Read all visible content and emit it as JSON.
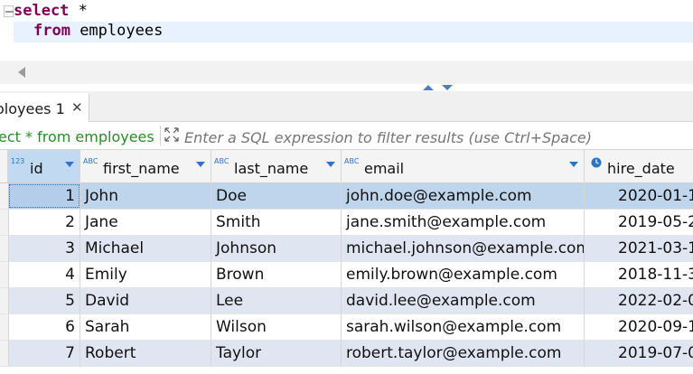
{
  "editor": {
    "line1": {
      "keyword": "select",
      "rest": " *"
    },
    "line2": {
      "keyword": "from",
      "rest": " employees"
    }
  },
  "results_tab": {
    "label": "oloyees 1",
    "close": "✕"
  },
  "filter": {
    "query_text": "ect * from employees",
    "placeholder": "Enter a SQL expression to filter results (use Ctrl+Space)"
  },
  "columns": [
    {
      "type": "123",
      "name": "id"
    },
    {
      "type": "ABC",
      "name": "first_name"
    },
    {
      "type": "ABC",
      "name": "last_name"
    },
    {
      "type": "ABC",
      "name": "email"
    },
    {
      "type": "clock-icon",
      "name": "hire_date"
    }
  ],
  "rows": [
    {
      "id": "1",
      "first_name": "John",
      "last_name": "Doe",
      "email": "john.doe@example.com",
      "hire_date": "2020-01-1"
    },
    {
      "id": "2",
      "first_name": "Jane",
      "last_name": "Smith",
      "email": "jane.smith@example.com",
      "hire_date": "2019-05-2"
    },
    {
      "id": "3",
      "first_name": "Michael",
      "last_name": "Johnson",
      "email": "michael.johnson@example.com",
      "hire_date": "2021-03-1"
    },
    {
      "id": "4",
      "first_name": "Emily",
      "last_name": "Brown",
      "email": "emily.brown@example.com",
      "hire_date": "2018-11-3"
    },
    {
      "id": "5",
      "first_name": "David",
      "last_name": "Lee",
      "email": "david.lee@example.com",
      "hire_date": "2022-02-0"
    },
    {
      "id": "6",
      "first_name": "Sarah",
      "last_name": "Wilson",
      "email": "sarah.wilson@example.com",
      "hire_date": "2020-09-1"
    },
    {
      "id": "7",
      "first_name": "Robert",
      "last_name": "Taylor",
      "email": "robert.taylor@example.com",
      "hire_date": "2019-07-0"
    }
  ],
  "colors": {
    "keyword": "#7f0055",
    "accent": "#2f74c0",
    "filter_query": "#2a8a2a"
  }
}
